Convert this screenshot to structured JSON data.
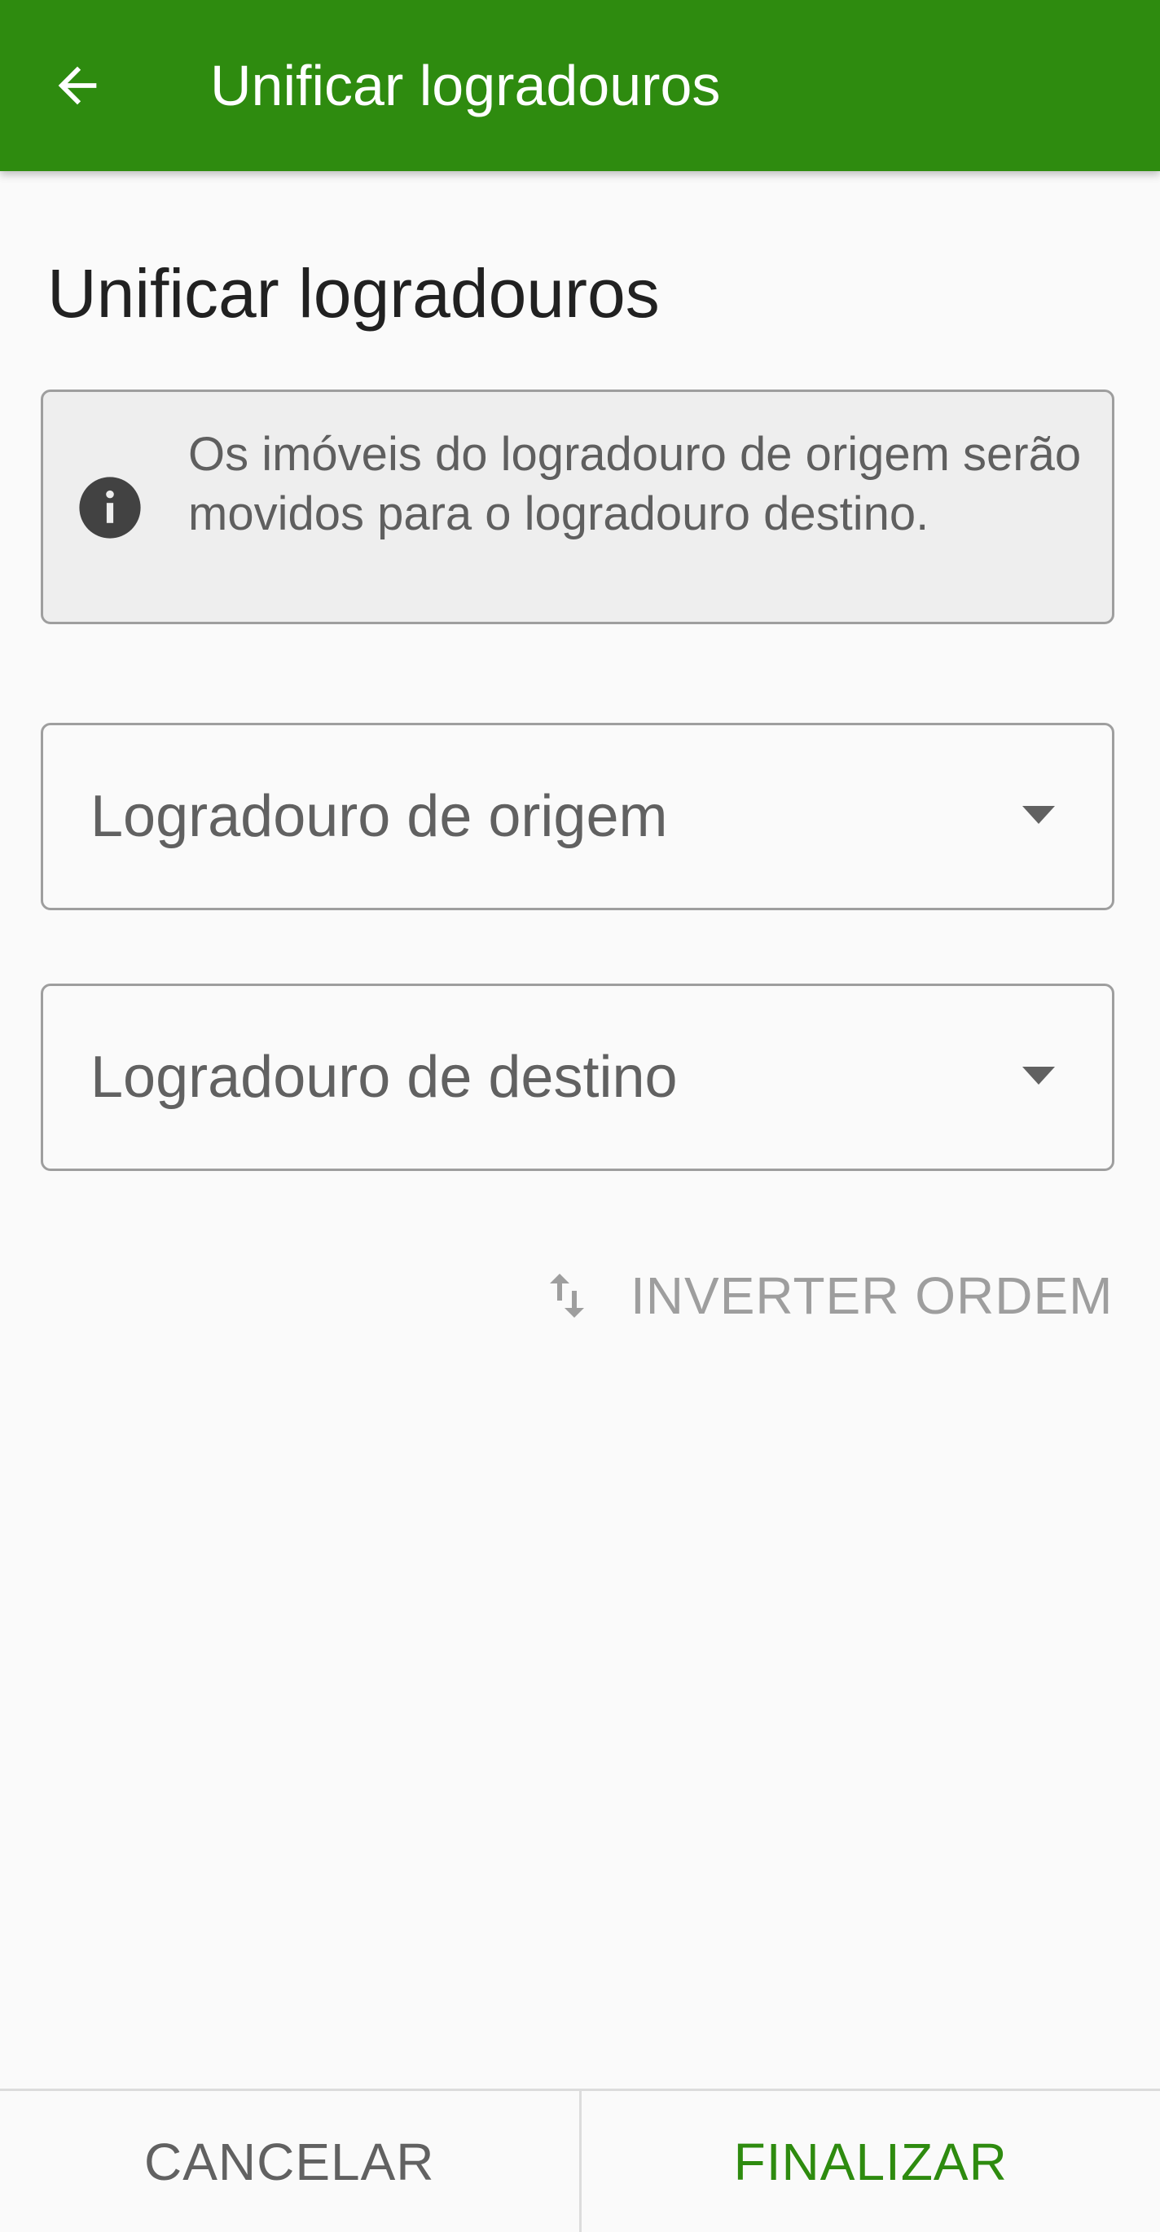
{
  "toolbar": {
    "title": "Unificar logradouros",
    "back_icon": "arrow-back-icon",
    "color": "#2e8b0f"
  },
  "page": {
    "title": "Unificar logradouros"
  },
  "info": {
    "icon": "info-icon",
    "text": "Os imóveis do logradouro de origem serão movidos para o logradouro destino."
  },
  "origin_select": {
    "placeholder": "Logradouro de origem",
    "icon": "dropdown-arrow-icon"
  },
  "destination_select": {
    "placeholder": "Logradouro de destino",
    "icon": "dropdown-arrow-icon"
  },
  "swap": {
    "label": "INVERTER ORDEM",
    "icon": "swap-vertical-icon"
  },
  "actions": {
    "cancel_label": "CANCELAR",
    "finish_label": "FINALIZAR",
    "finish_color": "#2e8b0f"
  }
}
